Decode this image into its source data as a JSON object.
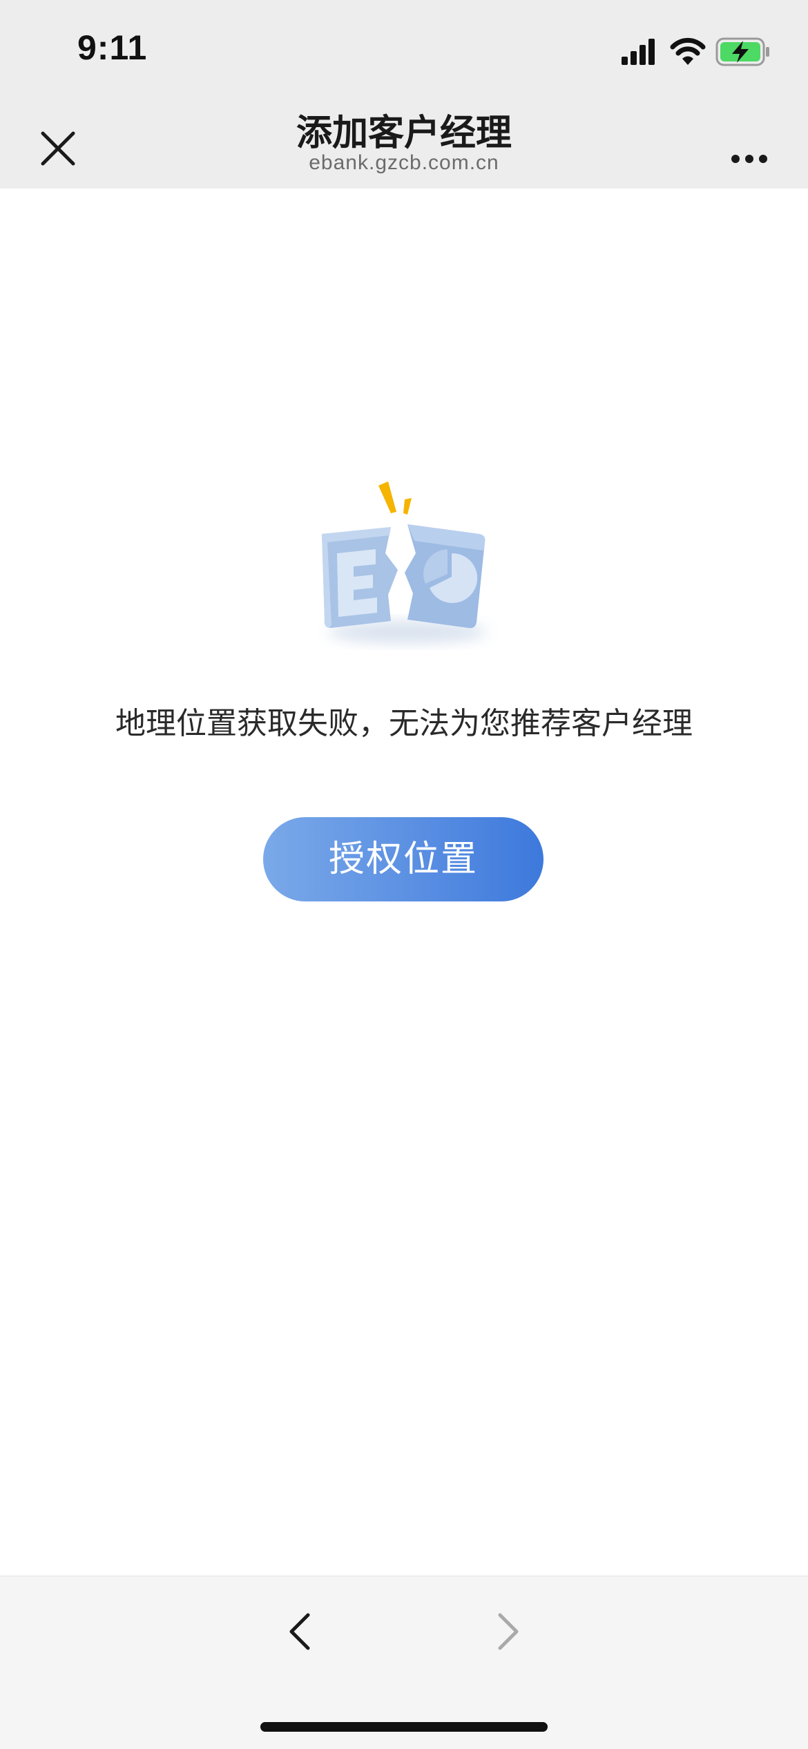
{
  "status_bar": {
    "time": "9:11",
    "icons": [
      "signal-icon",
      "wifi-icon",
      "battery-charging-icon"
    ],
    "battery_color": "#4cd964"
  },
  "header": {
    "title": "添加客户经理",
    "subtitle": "ebank.gzcb.com.cn",
    "close_icon": "close-icon",
    "more_icon": "more-icon"
  },
  "main": {
    "illustration_icon": "broken-document-icon",
    "message": "地理位置获取失败，无法为您推荐客户经理",
    "authorize_button": "授权位置",
    "accent_color": "#4a84e0"
  },
  "toolbar": {
    "back_icon": "back-arrow-icon",
    "forward_icon": "forward-arrow-icon"
  }
}
